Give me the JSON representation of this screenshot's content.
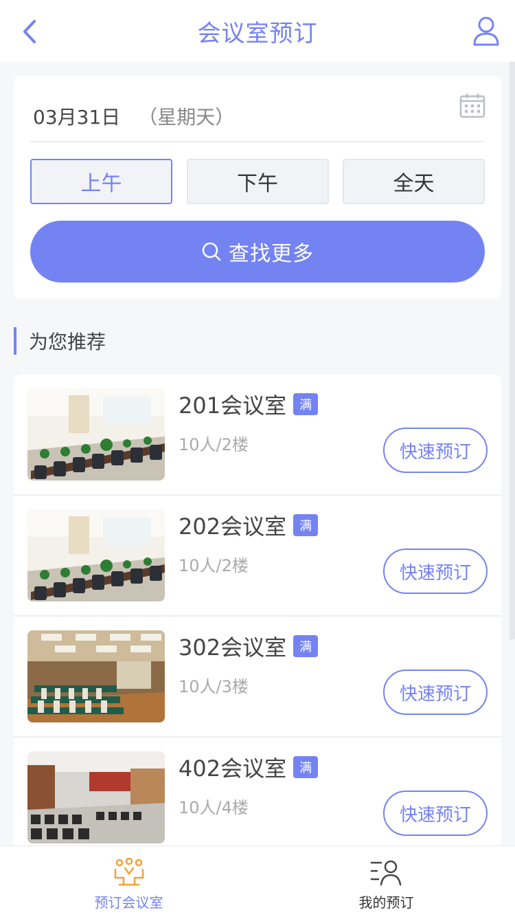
{
  "header": {
    "title": "会议室预订",
    "back_icon": "chevron-left-icon",
    "user_icon": "user-icon"
  },
  "search": {
    "date": "03月31日",
    "weekday": "（星期天）",
    "calendar_icon": "calendar-icon",
    "segments": [
      "上午",
      "下午",
      "全天"
    ],
    "selected_segment": "上午",
    "search_button": "查找更多",
    "search_icon": "search-icon"
  },
  "section": {
    "title": "为您推荐"
  },
  "rooms": [
    {
      "name": "201会议室",
      "badge": "满",
      "meta": "10人/2楼",
      "action": "快速预订"
    },
    {
      "name": "202会议室",
      "badge": "满",
      "meta": "10人/2楼",
      "action": "快速预订"
    },
    {
      "name": "302会议室",
      "badge": "满",
      "meta": "10人/3楼",
      "action": "快速预订"
    },
    {
      "name": "402会议室",
      "badge": "满",
      "meta": "10人/4楼",
      "action": "快速预订"
    }
  ],
  "tabbar": [
    {
      "label": "预订会议室",
      "icon": "meeting-room-icon",
      "active": true
    },
    {
      "label": "我的预订",
      "icon": "my-booking-icon",
      "active": false
    }
  ],
  "colors": {
    "accent": "#7483f2",
    "active_tab_icon": "#f4a13a"
  }
}
